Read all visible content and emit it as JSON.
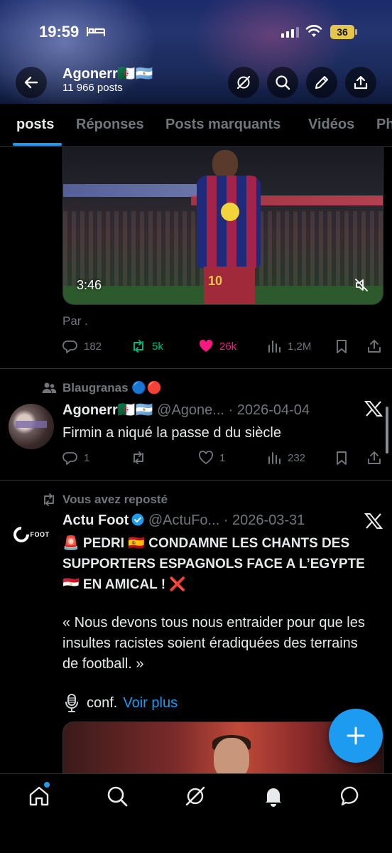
{
  "status_bar": {
    "time": "19:59",
    "battery": "36"
  },
  "header": {
    "name": "Agonerr🇩🇿🇦🇷",
    "posts_count": "11 966 posts"
  },
  "tabs": [
    {
      "label": "posts"
    },
    {
      "label": "Réponses"
    },
    {
      "label": "Posts marquants"
    },
    {
      "label": "Vidéos"
    },
    {
      "label": "Ph"
    }
  ],
  "post1": {
    "video_duration": "3:46",
    "jersey_number": "10",
    "caption": "Par .",
    "replies": "182",
    "reposts": "5k",
    "likes": "26k",
    "views": "1,2M",
    "colors": {
      "repost": "#00ba7c",
      "like": "#f91880"
    }
  },
  "post2": {
    "community": "Blaugranas 🔵🔴",
    "author_name": "Agonerr🇩🇿🇦🇷",
    "handle": "@Agone...",
    "date": "· 2026-04-04",
    "text": "Firmin a niqué la passe d du siècle",
    "replies": "1",
    "reposts": "",
    "likes": "1",
    "views": "232"
  },
  "post3": {
    "repost_context": "Vous avez reposté",
    "author_name": "Actu Foot",
    "handle": "@ActuFo...",
    "date": "· 2026-03-31",
    "avatar_text": "FOOT",
    "headline": "🚨 PEDRI 🇪🇸 CONDAMNE LES CHANTS DES SUPPORTERS ESPAGNOLS FACE A L’EGYPTE 🇪🇬 EN AMICAL ! ❌",
    "quote": "« Nous devons tous nous entraider pour que les insultes racistes soient éradiquées des terrains de football. »",
    "more_prefix": "conf.",
    "more_link": "Voir plus"
  },
  "accent_color": "#1d9bf0",
  "icons": [
    "back-arrow-icon",
    "grok-icon",
    "search-icon",
    "pencil-icon",
    "share-icon",
    "home-icon",
    "bell-icon",
    "message-icon",
    "x-logo-icon",
    "microphone-icon",
    "mute-icon",
    "community-icon",
    "repost-icon",
    "verified-icon"
  ]
}
